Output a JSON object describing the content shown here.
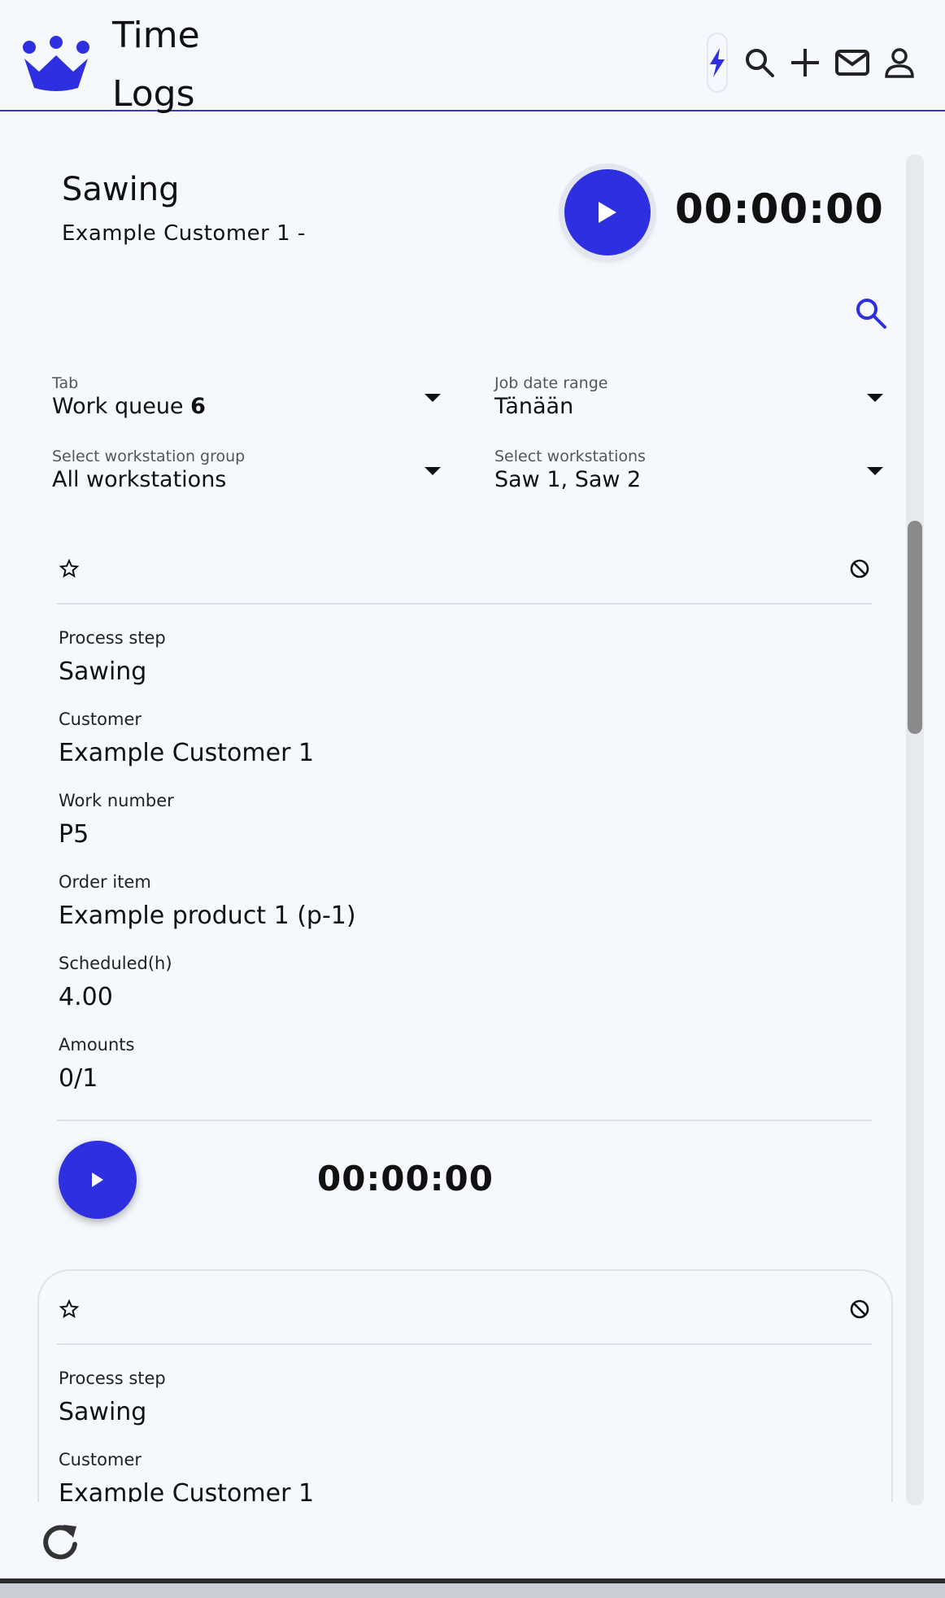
{
  "header": {
    "title_line1": "Time",
    "title_line2": "Logs",
    "icons": [
      "bolt-icon",
      "search-icon",
      "plus-icon",
      "mail-icon",
      "user-icon"
    ],
    "accent_color": "#2d2fe0",
    "border_color": "#3d3ac4"
  },
  "current_task": {
    "title": "Sawing",
    "subtitle": "Example Customer 1 -",
    "timer": "00:00:00"
  },
  "filters": {
    "tab": {
      "label": "Tab",
      "value": "Work queue",
      "count": "6"
    },
    "job_date_range": {
      "label": "Job date range",
      "value": "Tänään"
    },
    "workstation_group": {
      "label": "Select workstation group",
      "value": "All workstations"
    },
    "workstations": {
      "label": "Select workstations",
      "value": "Saw 1, Saw 2"
    }
  },
  "cards": [
    {
      "fields": [
        {
          "label": "Process step",
          "value": "Sawing"
        },
        {
          "label": "Customer",
          "value": "Example Customer 1"
        },
        {
          "label": "Work number",
          "value": "P5"
        },
        {
          "label": "Order item",
          "value": "Example product 1 (p-1)"
        },
        {
          "label": "Scheduled(h)",
          "value": "4.00"
        },
        {
          "label": "Amounts",
          "value": "0/1"
        }
      ],
      "timer": "00:00:00"
    },
    {
      "fields": [
        {
          "label": "Process step",
          "value": "Sawing"
        },
        {
          "label": "Customer",
          "value": "Example Customer 1"
        }
      ]
    }
  ]
}
